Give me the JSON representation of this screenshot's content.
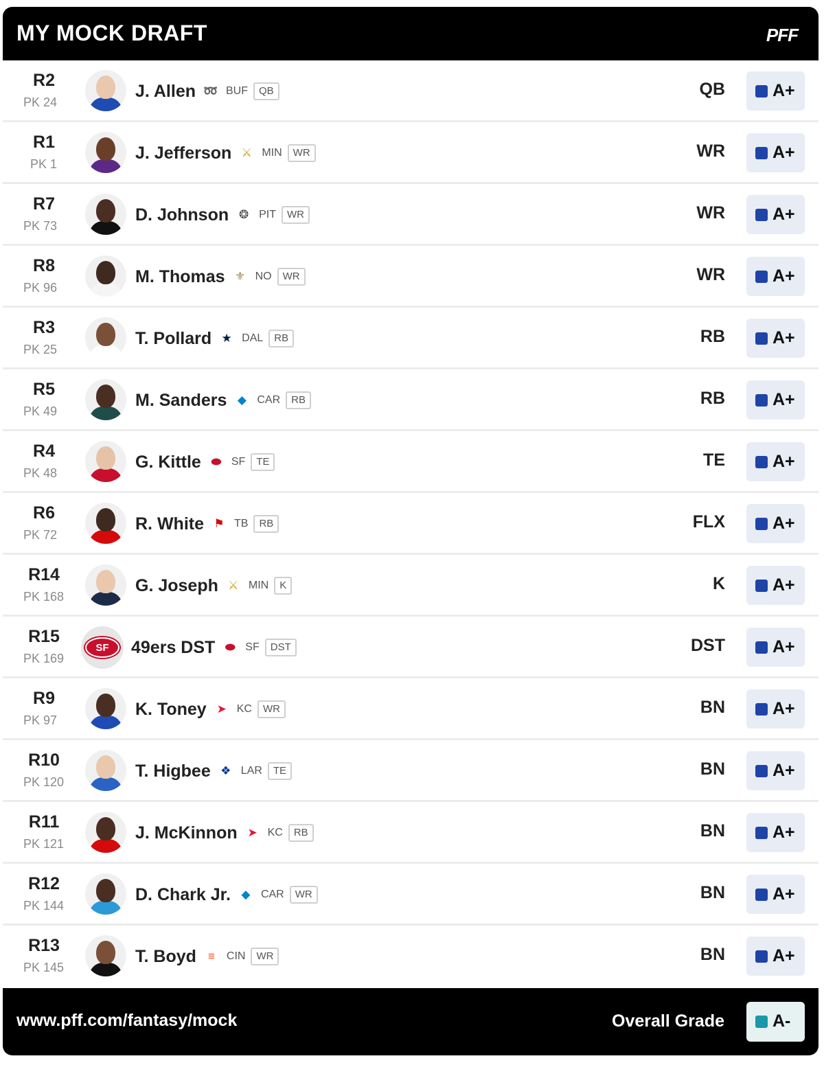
{
  "header": {
    "title": "MY MOCK DRAFT",
    "logo": "PFF"
  },
  "footer": {
    "url": "www.pff.com/fantasy/mock",
    "overall_label": "Overall Grade",
    "overall_grade": "A-",
    "overall_color": "#1a97a8"
  },
  "grade_color": "#1f44a8",
  "players": [
    {
      "round": "R2",
      "pick": "PK 24",
      "name": "J. Allen",
      "team": "BUF",
      "team_icon": "bills-icon",
      "pos": "QB",
      "slot": "QB",
      "grade": "A+",
      "skin": "#e9c8ad",
      "shirt": "#1f4bb4"
    },
    {
      "round": "R1",
      "pick": "PK 1",
      "name": "J. Jefferson",
      "team": "MIN",
      "team_icon": "vikings-icon",
      "pos": "WR",
      "slot": "WR",
      "grade": "A+",
      "skin": "#6a3f2a",
      "shirt": "#5b2a86"
    },
    {
      "round": "R7",
      "pick": "PK 73",
      "name": "D. Johnson",
      "team": "PIT",
      "team_icon": "steelers-icon",
      "pos": "WR",
      "slot": "WR",
      "grade": "A+",
      "skin": "#4a2e22",
      "shirt": "#111111"
    },
    {
      "round": "R8",
      "pick": "PK 96",
      "name": "M. Thomas",
      "team": "NO",
      "team_icon": "saints-icon",
      "pos": "WR",
      "slot": "WR",
      "grade": "A+",
      "skin": "#3f2a20",
      "shirt": "#f5f5f5"
    },
    {
      "round": "R3",
      "pick": "PK 25",
      "name": "T. Pollard",
      "team": "DAL",
      "team_icon": "cowboys-icon",
      "pos": "RB",
      "slot": "RB",
      "grade": "A+",
      "skin": "#7a5038",
      "shirt": "#ffffff"
    },
    {
      "round": "R5",
      "pick": "PK 49",
      "name": "M. Sanders",
      "team": "CAR",
      "team_icon": "panthers-icon",
      "pos": "RB",
      "slot": "RB",
      "grade": "A+",
      "skin": "#4a2e22",
      "shirt": "#1e4d4a"
    },
    {
      "round": "R4",
      "pick": "PK 48",
      "name": "G. Kittle",
      "team": "SF",
      "team_icon": "49ers-icon",
      "pos": "TE",
      "slot": "TE",
      "grade": "A+",
      "skin": "#e6c3a8",
      "shirt": "#c8102e"
    },
    {
      "round": "R6",
      "pick": "PK 72",
      "name": "R. White",
      "team": "TB",
      "team_icon": "buccaneers-icon",
      "pos": "RB",
      "slot": "FLX",
      "grade": "A+",
      "skin": "#3f2a20",
      "shirt": "#d50a0a"
    },
    {
      "round": "R14",
      "pick": "PK 168",
      "name": "G. Joseph",
      "team": "MIN",
      "team_icon": "vikings-icon",
      "pos": "K",
      "slot": "K",
      "grade": "A+",
      "skin": "#e9c8ad",
      "shirt": "#1c2b48"
    },
    {
      "round": "R15",
      "pick": "PK 169",
      "name": "49ers DST",
      "team": "SF",
      "team_icon": "49ers-icon",
      "pos": "DST",
      "slot": "DST",
      "grade": "A+",
      "is_team": true,
      "logo_text": "SF"
    },
    {
      "round": "R9",
      "pick": "PK 97",
      "name": "K. Toney",
      "team": "KC",
      "team_icon": "chiefs-icon",
      "pos": "WR",
      "slot": "BN",
      "grade": "A+",
      "skin": "#4a2e22",
      "shirt": "#1f4bb4"
    },
    {
      "round": "R10",
      "pick": "PK 120",
      "name": "T. Higbee",
      "team": "LAR",
      "team_icon": "rams-icon",
      "pos": "TE",
      "slot": "BN",
      "grade": "A+",
      "skin": "#e9c8ad",
      "shirt": "#2a63c4"
    },
    {
      "round": "R11",
      "pick": "PK 121",
      "name": "J. McKinnon",
      "team": "KC",
      "team_icon": "chiefs-icon",
      "pos": "RB",
      "slot": "BN",
      "grade": "A+",
      "skin": "#4a2e22",
      "shirt": "#d50a0a"
    },
    {
      "round": "R12",
      "pick": "PK 144",
      "name": "D. Chark Jr.",
      "team": "CAR",
      "team_icon": "panthers-icon",
      "pos": "WR",
      "slot": "BN",
      "grade": "A+",
      "skin": "#4a2e22",
      "shirt": "#2b9ad6"
    },
    {
      "round": "R13",
      "pick": "PK 145",
      "name": "T. Boyd",
      "team": "CIN",
      "team_icon": "bengals-icon",
      "pos": "WR",
      "slot": "BN",
      "grade": "A+",
      "skin": "#7a5038",
      "shirt": "#111111"
    }
  ]
}
